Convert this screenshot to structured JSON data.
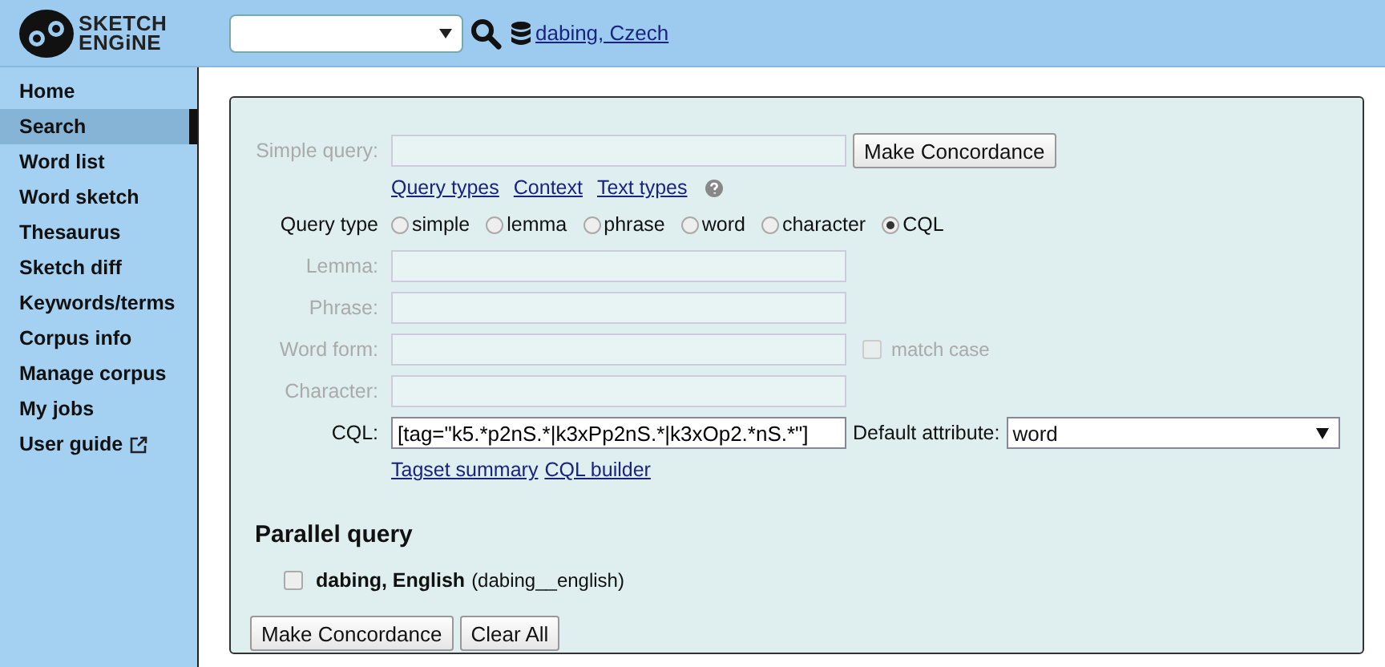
{
  "header": {
    "logo_lines": [
      "SKETCH",
      "ENGiNE"
    ],
    "corpus_link": "dabing, Czech"
  },
  "sidebar": {
    "items": [
      {
        "label": "Home",
        "selected": false,
        "external": false
      },
      {
        "label": "Search",
        "selected": true,
        "external": false
      },
      {
        "label": "Word list",
        "selected": false,
        "external": false
      },
      {
        "label": "Word sketch",
        "selected": false,
        "external": false
      },
      {
        "label": "Thesaurus",
        "selected": false,
        "external": false
      },
      {
        "label": "Sketch diff",
        "selected": false,
        "external": false
      },
      {
        "label": "Keywords/terms",
        "selected": false,
        "external": false
      },
      {
        "label": "Corpus info",
        "selected": false,
        "external": false
      },
      {
        "label": "Manage corpus",
        "selected": false,
        "external": false
      },
      {
        "label": "My jobs",
        "selected": false,
        "external": false
      },
      {
        "label": "User guide",
        "selected": false,
        "external": true
      }
    ]
  },
  "form": {
    "simple_query": {
      "label": "Simple query:",
      "disabled": true,
      "button": "Make Concordance"
    },
    "links": [
      "Query types",
      "Context",
      "Text types"
    ],
    "query_type": {
      "label": "Query type",
      "options": [
        {
          "label": "simple",
          "selected": false
        },
        {
          "label": "lemma",
          "selected": false
        },
        {
          "label": "phrase",
          "selected": false
        },
        {
          "label": "word",
          "selected": false
        },
        {
          "label": "character",
          "selected": false
        },
        {
          "label": "CQL",
          "selected": true
        }
      ]
    },
    "fields": [
      {
        "label": "Lemma:",
        "disabled": true
      },
      {
        "label": "Phrase:",
        "disabled": true
      },
      {
        "label": "Word form:",
        "disabled": true,
        "match_case": {
          "label": "match case",
          "checked": false,
          "disabled": true
        }
      },
      {
        "label": "Character:",
        "disabled": true
      }
    ],
    "cql": {
      "label": "CQL:",
      "value": "[tag=\"k5.*p2nS.*|k3xPp2nS.*|k3xOp2.*nS.*\"]",
      "default_attribute_label": "Default attribute:",
      "default_attribute": "word"
    },
    "cql_links": [
      "Tagset summary",
      "CQL builder"
    ],
    "parallel": {
      "title": "Parallel query",
      "corpora": [
        {
          "name": "dabing, English",
          "id": "(dabing__english)",
          "checked": false
        }
      ]
    },
    "buttons": [
      "Make Concordance",
      "Clear All"
    ]
  }
}
